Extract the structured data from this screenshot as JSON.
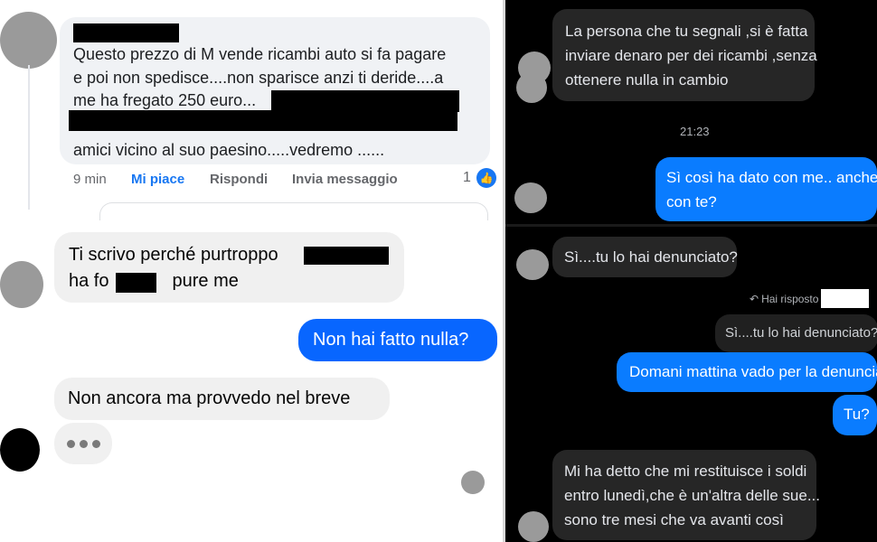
{
  "facebook_comment": {
    "lines": [
      "Questo prezzo di M vende ricambi auto si fa pagare",
      "e poi non spedisce....non sparisce anzi ti deride....a",
      "me ha fregato 250 euro...",
      "",
      "amici vicino al suo paesino.....vedremo ......"
    ],
    "time": "9 min",
    "like_label": "Mi piace",
    "reply_label": "Rispondi",
    "message_label": "Invia messaggio",
    "like_count": "1",
    "like_icon": "thumbs-up-icon"
  },
  "messenger_light": {
    "messages": [
      {
        "text_a": "Ti scrivo perché purtroppo",
        "text_b": "ha fo",
        "text_c": "pure me"
      },
      {
        "text": "Non hai fatto nulla?"
      },
      {
        "text": "Non ancora ma provvedo nel breve"
      }
    ]
  },
  "messenger_dark": {
    "msg1": [
      "La persona che tu segnali ,si è fatta",
      "inviare denaro per dei ricambi ,senza",
      "ottenere nulla in cambio"
    ],
    "time": "21:23",
    "msg2": [
      "Sì così ha dato con me.. anche",
      "con te?"
    ],
    "msg3": "Sì....tu lo hai denunciato?",
    "reply_label": "Hai risposto",
    "quoted": "Sì....tu lo hai denunciato?",
    "msg4": "Domani mattina vado per la denuncia",
    "msg5": "Tu?",
    "msg6": [
      "Mi ha detto che mi restituisce i soldi",
      "entro lunedì,che è un'altra delle sue...",
      "sono tre mesi che va avanti così"
    ]
  },
  "colors": {
    "fb_blue": "#1877f2",
    "messenger_blue": "#0866ff",
    "dark_bubble": "#262626"
  }
}
